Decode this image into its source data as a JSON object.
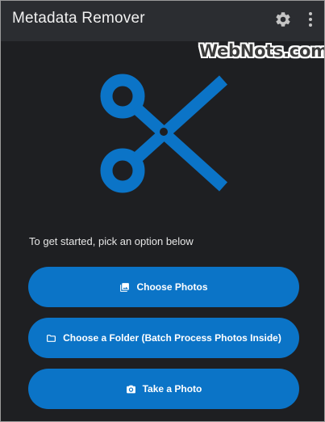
{
  "app": {
    "title": "Metadata Remover"
  },
  "watermark": "WebNots.com",
  "main": {
    "prompt": "To get started, pick an option below",
    "buttons": [
      {
        "label": "Choose Photos",
        "icon": "image-icon"
      },
      {
        "label": "Choose a Folder (Batch Process Photos Inside)",
        "icon": "folder-icon"
      },
      {
        "label": "Take a Photo",
        "icon": "camera-icon"
      }
    ]
  },
  "colors": {
    "background": "#1e1f22",
    "appbar": "#2b2d31",
    "accent": "#0b74c7",
    "text": "#f0f0f0"
  },
  "icons": {
    "hero": "scissors-icon",
    "settings": "gear-icon",
    "menu": "more-vert-icon"
  }
}
